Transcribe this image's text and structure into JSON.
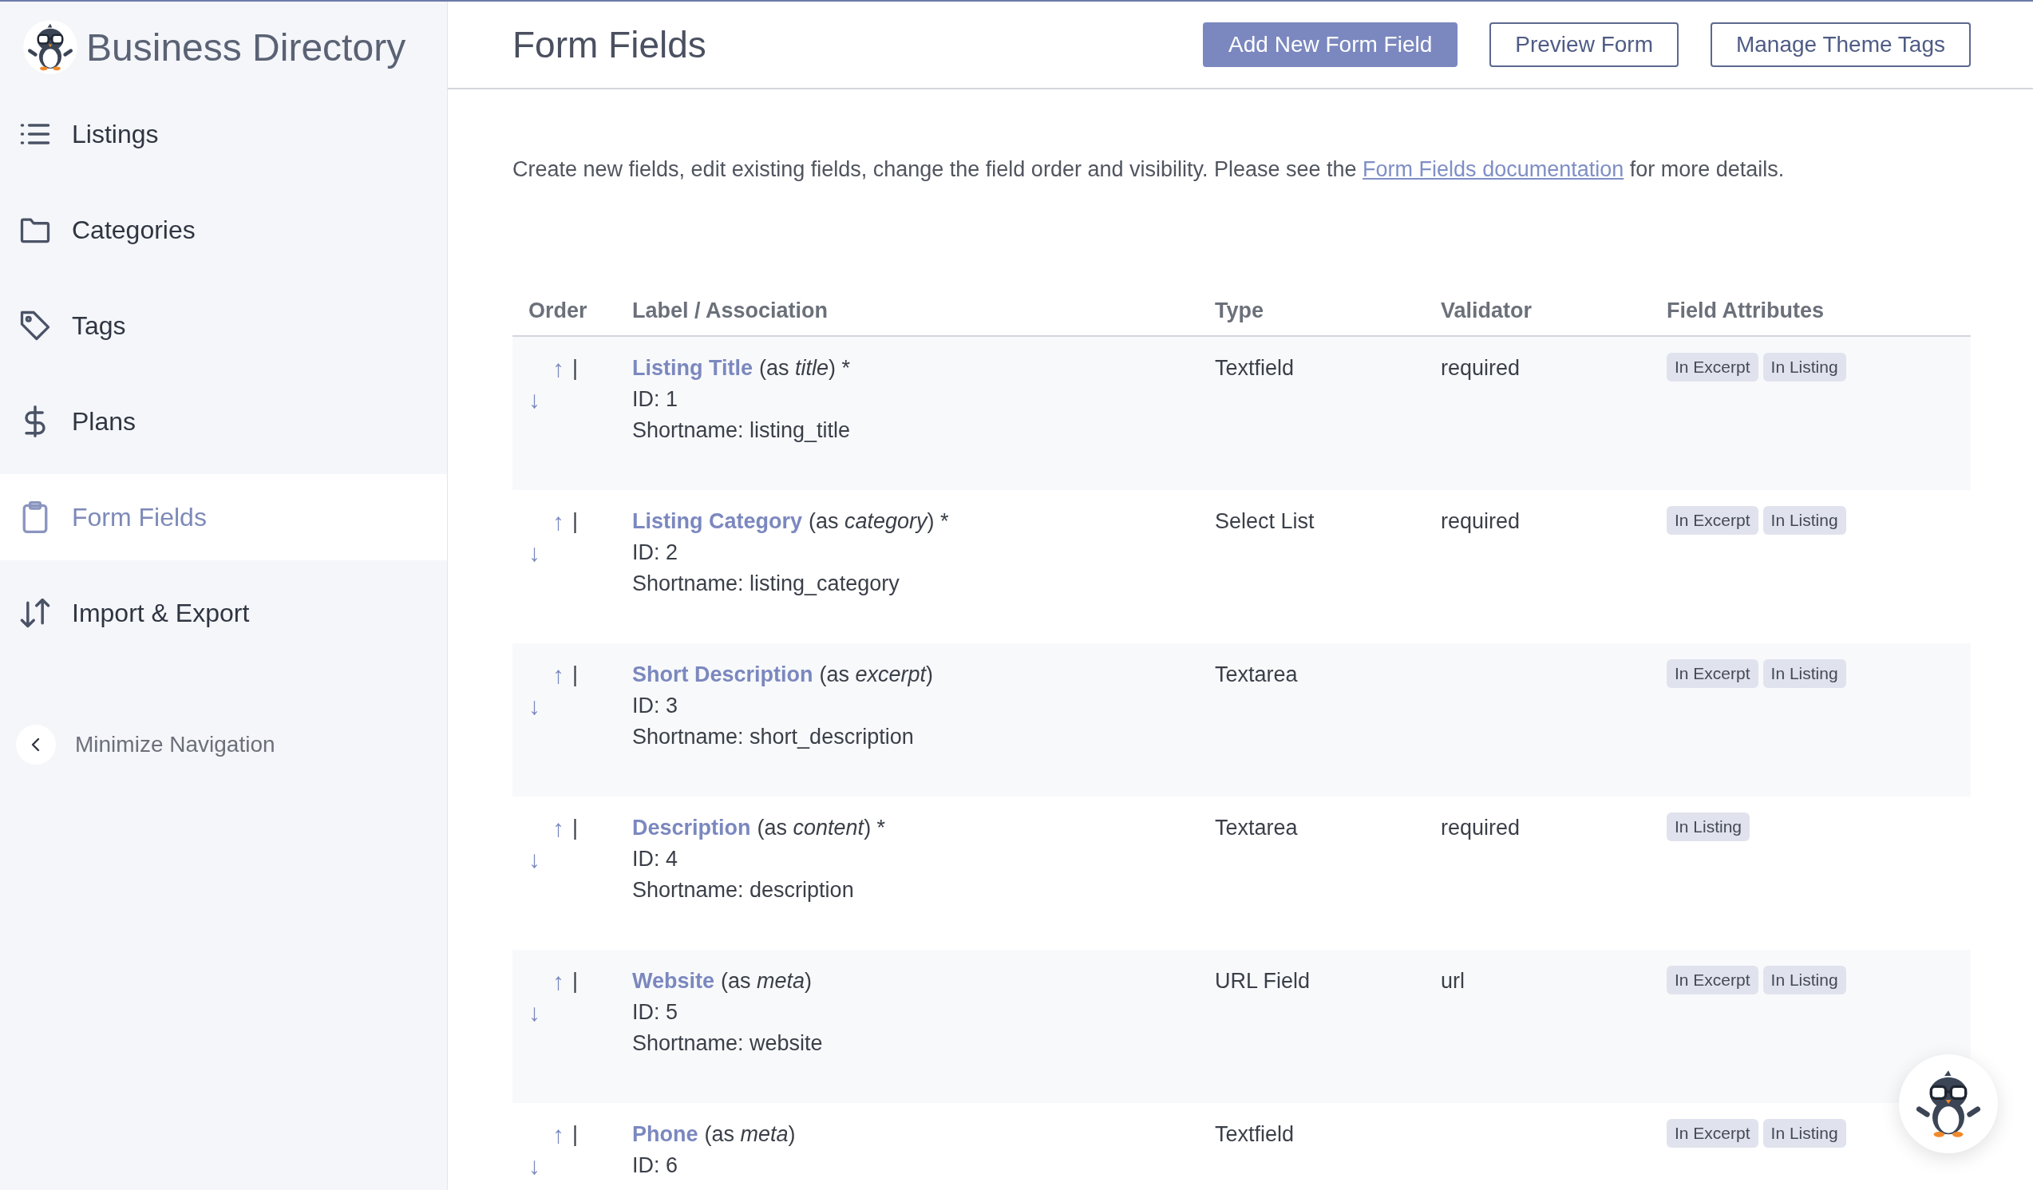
{
  "sidebar": {
    "brand": "Business Directory",
    "items": [
      {
        "label": "Listings",
        "selected": false
      },
      {
        "label": "Categories",
        "selected": false
      },
      {
        "label": "Tags",
        "selected": false
      },
      {
        "label": "Plans",
        "selected": false
      },
      {
        "label": "Form Fields",
        "selected": true
      },
      {
        "label": "Import & Export",
        "selected": false
      }
    ],
    "minimize": {
      "label": "Minimize Navigation"
    }
  },
  "header": {
    "title": "Form Fields",
    "buttons": [
      {
        "label": "Add New Form Field",
        "kind": "primary"
      },
      {
        "label": "Preview Form",
        "kind": "secondary"
      },
      {
        "label": "Manage Theme Tags",
        "kind": "secondary"
      }
    ]
  },
  "intro": {
    "before": "Create new fields, edit existing fields, change the field order and visibility. Please see the",
    "link": "Form Fields documentation",
    "after": "for more details."
  },
  "table": {
    "columns": [
      "Order",
      "Label / Association",
      "Type",
      "Validator",
      "Field Attributes"
    ],
    "rows": [
      {
        "order": {
          "up": "↑",
          "separator": "|",
          "down": "↓"
        },
        "label": "Listing Title",
        "association": "(as *title*) *",
        "id": "ID: 1",
        "shortname": "Shortname: listing_title",
        "type": "Textfield",
        "validator": "required",
        "attributes": [
          "In Excerpt",
          "In Listing"
        ]
      },
      {
        "order": {
          "up": "↑",
          "separator": "|",
          "down": "↓"
        },
        "label": "Listing Category",
        "association": "(as *category*) *",
        "id": "ID: 2",
        "shortname": "Shortname: listing_category",
        "type": "Select List",
        "validator": "required",
        "attributes": [
          "In Excerpt",
          "In Listing"
        ]
      },
      {
        "order": {
          "up": "↑",
          "separator": "|",
          "down": "↓"
        },
        "label": "Short Description",
        "association": "(as *excerpt*)",
        "id": "ID: 3",
        "shortname": "Shortname: short_description",
        "type": "Textarea",
        "attributes": [
          "In Excerpt",
          "In Listing"
        ]
      },
      {
        "order": {
          "up": "↑",
          "separator": "|",
          "down": "↓"
        },
        "label": "Description",
        "association": "(as *content*) *",
        "id": "ID: 4",
        "shortname": "Shortname: description",
        "type": "Textarea",
        "validator": "required",
        "attributes": [
          "In Listing"
        ]
      },
      {
        "order": {
          "up": "↑",
          "separator": "|",
          "down": "↓"
        },
        "label": "Website",
        "association": "(as *meta*)",
        "id": "ID: 5",
        "shortname": "Shortname: website",
        "type": "URL Field",
        "validator": "url",
        "attributes": [
          "In Excerpt",
          "In Listing"
        ]
      },
      {
        "order": {
          "up": "↑",
          "separator": "|",
          "down": "↓"
        },
        "label": "Phone",
        "association": "(as *meta*)",
        "id": "ID: 6",
        "type": "Textfield",
        "attributes": [
          "In Excerpt",
          "In Listing"
        ]
      }
    ]
  }
}
